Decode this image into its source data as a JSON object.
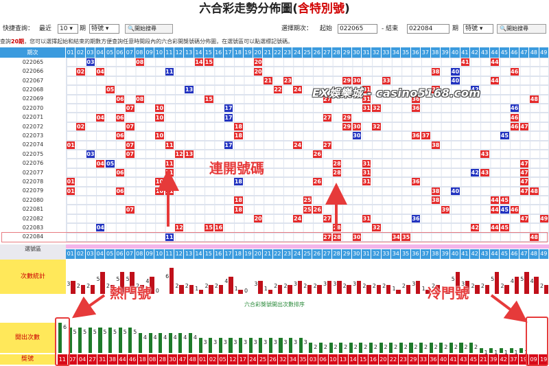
{
  "header": {
    "title_main": "六合彩走勢分佈圖",
    "title_paren_open": "(",
    "title_special": "含特別號",
    "title_paren_close": ")"
  },
  "query": {
    "quick_label": "快捷查詢：",
    "recent_label": "最近",
    "recent_value": "10",
    "period_unit": "期",
    "special_select": "特號",
    "search_button": "開始搜尋",
    "choose_label": "選擇期次：",
    "start_label": "起始",
    "start_value": "022065",
    "sep_label": "- 結束",
    "end_value": "022084",
    "period_unit2": "期",
    "special_select2": "特號",
    "search_button2": "開始搜尋"
  },
  "info": {
    "prefix": "查詢",
    "count": "20期",
    "text": "，您可以選擇起始和結束的期數方便查詢任意時間段內的六合彩開獎號碼分佈圖，在選號區可以點選標記號碼。"
  },
  "grid": {
    "period_header": "期次",
    "numbers": [
      "01",
      "02",
      "03",
      "04",
      "05",
      "06",
      "07",
      "08",
      "09",
      "10",
      "11",
      "12",
      "13",
      "14",
      "15",
      "16",
      "17",
      "18",
      "19",
      "20",
      "21",
      "22",
      "23",
      "24",
      "25",
      "26",
      "27",
      "28",
      "29",
      "30",
      "31",
      "32",
      "33",
      "34",
      "35",
      "36",
      "37",
      "38",
      "39",
      "40",
      "41",
      "42",
      "43",
      "44",
      "45",
      "46",
      "47",
      "48",
      "49"
    ],
    "rows": [
      {
        "period": "022065",
        "balls": [
          [
            3,
            "blue"
          ],
          [
            8,
            "red"
          ],
          [
            14,
            "red"
          ],
          [
            15,
            "red"
          ],
          [
            20,
            "red"
          ],
          [
            41,
            "red"
          ],
          [
            44,
            "red"
          ]
        ]
      },
      {
        "period": "022066",
        "balls": [
          [
            2,
            "red"
          ],
          [
            4,
            "red"
          ],
          [
            11,
            "blue"
          ],
          [
            20,
            "red"
          ],
          [
            38,
            "red"
          ],
          [
            40,
            "blue"
          ],
          [
            46,
            "red"
          ]
        ]
      },
      {
        "period": "022067",
        "balls": [
          [
            21,
            "red"
          ],
          [
            23,
            "red"
          ],
          [
            29,
            "red"
          ],
          [
            30,
            "red"
          ],
          [
            33,
            "red"
          ],
          [
            40,
            "blue"
          ],
          [
            44,
            "red"
          ]
        ]
      },
      {
        "period": "022068",
        "balls": [
          [
            5,
            "red"
          ],
          [
            13,
            "blue"
          ],
          [
            22,
            "red"
          ],
          [
            24,
            "red"
          ],
          [
            31,
            "red"
          ],
          [
            38,
            "red"
          ],
          [
            42,
            "blue"
          ]
        ]
      },
      {
        "period": "022069",
        "balls": [
          [
            6,
            "red"
          ],
          [
            8,
            "red"
          ],
          [
            15,
            "red"
          ],
          [
            27,
            "red"
          ],
          [
            31,
            "red"
          ],
          [
            36,
            "red"
          ],
          [
            48,
            "red"
          ]
        ]
      },
      {
        "period": "022070",
        "balls": [
          [
            7,
            "red"
          ],
          [
            10,
            "red"
          ],
          [
            17,
            "blue"
          ],
          [
            31,
            "red"
          ],
          [
            32,
            "red"
          ],
          [
            36,
            "red"
          ],
          [
            46,
            "blue"
          ]
        ]
      },
      {
        "period": "022071",
        "balls": [
          [
            4,
            "red"
          ],
          [
            6,
            "red"
          ],
          [
            10,
            "red"
          ],
          [
            17,
            "blue"
          ],
          [
            27,
            "red"
          ],
          [
            29,
            "red"
          ],
          [
            46,
            "red"
          ]
        ]
      },
      {
        "period": "022072",
        "balls": [
          [
            2,
            "red"
          ],
          [
            7,
            "red"
          ],
          [
            18,
            "red"
          ],
          [
            29,
            "red"
          ],
          [
            30,
            "red"
          ],
          [
            32,
            "red"
          ],
          [
            46,
            "red"
          ],
          [
            47,
            "red"
          ]
        ]
      },
      {
        "period": "022073",
        "balls": [
          [
            6,
            "red"
          ],
          [
            10,
            "red"
          ],
          [
            18,
            "red"
          ],
          [
            30,
            "blue"
          ],
          [
            36,
            "red"
          ],
          [
            37,
            "red"
          ],
          [
            45,
            "blue"
          ]
        ]
      },
      {
        "period": "022074",
        "balls": [
          [
            1,
            "red"
          ],
          [
            7,
            "red"
          ],
          [
            11,
            "red"
          ],
          [
            17,
            "blue"
          ],
          [
            24,
            "red"
          ],
          [
            27,
            "red"
          ],
          [
            38,
            "red"
          ]
        ]
      },
      {
        "period": "022075",
        "balls": [
          [
            3,
            "blue"
          ],
          [
            7,
            "red"
          ],
          [
            12,
            "red"
          ],
          [
            13,
            "red"
          ],
          [
            26,
            "red"
          ],
          [
            43,
            "red"
          ]
        ]
      },
      {
        "period": "022076",
        "balls": [
          [
            4,
            "red"
          ],
          [
            5,
            "blue"
          ],
          [
            11,
            "red"
          ],
          [
            28,
            "red"
          ],
          [
            31,
            "red"
          ],
          [
            47,
            "red"
          ]
        ]
      },
      {
        "period": "022077",
        "balls": [
          [
            6,
            "red"
          ],
          [
            11,
            "red"
          ],
          [
            28,
            "red"
          ],
          [
            31,
            "red"
          ],
          [
            42,
            "blue"
          ],
          [
            43,
            "red"
          ],
          [
            47,
            "red"
          ]
        ]
      },
      {
        "period": "022078",
        "balls": [
          [
            1,
            "red"
          ],
          [
            10,
            "red"
          ],
          [
            18,
            "blue"
          ],
          [
            26,
            "red"
          ],
          [
            31,
            "red"
          ],
          [
            36,
            "red"
          ],
          [
            47,
            "red"
          ]
        ]
      },
      {
        "period": "022079",
        "balls": [
          [
            1,
            "red"
          ],
          [
            6,
            "red"
          ],
          [
            10,
            "red"
          ],
          [
            11,
            "red"
          ],
          [
            38,
            "red"
          ],
          [
            40,
            "blue"
          ],
          [
            47,
            "red"
          ],
          [
            48,
            "red"
          ]
        ]
      },
      {
        "period": "022080",
        "balls": [
          [
            18,
            "red"
          ],
          [
            25,
            "red"
          ],
          [
            38,
            "red"
          ],
          [
            44,
            "red"
          ],
          [
            45,
            "red"
          ]
        ]
      },
      {
        "period": "022081",
        "balls": [
          [
            7,
            "red"
          ],
          [
            18,
            "red"
          ],
          [
            25,
            "red"
          ],
          [
            26,
            "red"
          ],
          [
            39,
            "red"
          ],
          [
            44,
            "red"
          ],
          [
            45,
            "blue"
          ],
          [
            46,
            "red"
          ]
        ]
      },
      {
        "period": "022082",
        "balls": [
          [
            20,
            "red"
          ],
          [
            24,
            "red"
          ],
          [
            27,
            "red"
          ],
          [
            31,
            "red"
          ],
          [
            36,
            "blue"
          ],
          [
            47,
            "red"
          ],
          [
            49,
            "red"
          ]
        ]
      },
      {
        "period": "022083",
        "balls": [
          [
            4,
            "blue"
          ],
          [
            12,
            "red"
          ],
          [
            15,
            "red"
          ],
          [
            16,
            "red"
          ],
          [
            28,
            "red"
          ],
          [
            32,
            "red"
          ],
          [
            42,
            "red"
          ],
          [
            44,
            "red"
          ],
          [
            45,
            "red"
          ]
        ]
      },
      {
        "period": "022084",
        "balls": [
          [
            11,
            "blue"
          ],
          [
            27,
            "red"
          ],
          [
            28,
            "red"
          ],
          [
            30,
            "red"
          ],
          [
            34,
            "red"
          ],
          [
            35,
            "red"
          ],
          [
            48,
            "red"
          ]
        ]
      }
    ]
  },
  "select_area": {
    "label": "選號區"
  },
  "stats": {
    "label": "次數統計",
    "counts": [
      3,
      2,
      2,
      5,
      2,
      5,
      5,
      2,
      4,
      0,
      6,
      2,
      2,
      1,
      2,
      2,
      4,
      1,
      0,
      3,
      1,
      2,
      2,
      3,
      2,
      2,
      3,
      3,
      2,
      3,
      2,
      2,
      2,
      1,
      2,
      3,
      1,
      2,
      1,
      5,
      3,
      2,
      2,
      5,
      2,
      4,
      5,
      4,
      2
    ]
  },
  "sorted": {
    "title": "六合彩獎號開出次數排序",
    "count_label": "開出次數",
    "number_label": "獎號",
    "counts": [
      6,
      5,
      5,
      5,
      5,
      5,
      5,
      5,
      4,
      4,
      4,
      4,
      4,
      4,
      3,
      3,
      3,
      3,
      3,
      3,
      3,
      3,
      3,
      3,
      3,
      2,
      2,
      2,
      2,
      2,
      2,
      2,
      2,
      2,
      2,
      2,
      2,
      2,
      2,
      2,
      2,
      2,
      1,
      1,
      1,
      1,
      1,
      0,
      0
    ],
    "numbers": [
      "11",
      "07",
      "04",
      "27",
      "31",
      "38",
      "44",
      "46",
      "18",
      "08",
      "28",
      "30",
      "47",
      "48",
      "01",
      "02",
      "05",
      "12",
      "17",
      "24",
      "25",
      "26",
      "32",
      "34",
      "35",
      "03",
      "06",
      "10",
      "13",
      "14",
      "15",
      "16",
      "20",
      "22",
      "23",
      "29",
      "33",
      "36",
      "40",
      "41",
      "43",
      "45",
      "21",
      "39",
      "42",
      "37",
      "19",
      "09",
      "19"
    ]
  },
  "annotations": {
    "consecutive": "連開號碼",
    "hot": "熱門號",
    "cold": "冷門號",
    "watermark": "EX娛樂城 - casino5168.com"
  },
  "colors": {
    "header_blue": "#3b9bde",
    "ball_red": "#e52b2b",
    "ball_blue": "#2233c0",
    "bar_red": "#c0101a",
    "bar_green": "#1e7a2a",
    "label_yellow": "#ffe85a",
    "annotation_red": "#e63a3a"
  }
}
